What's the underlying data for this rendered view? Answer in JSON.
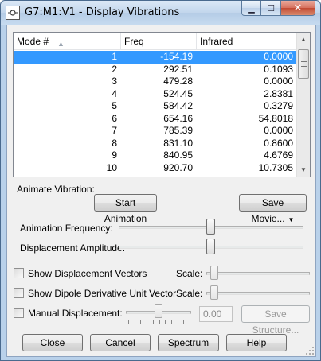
{
  "window": {
    "title": "G7:M1:V1 - Display Vibrations",
    "min_glyph": "▁",
    "max_glyph": "☐",
    "close_glyph": "✕"
  },
  "table": {
    "columns": [
      "Mode #",
      "Freq",
      "Infrared"
    ],
    "rows": [
      {
        "mode": "1",
        "freq": "-154.19",
        "ir": "0.0000"
      },
      {
        "mode": "2",
        "freq": "292.51",
        "ir": "0.1093"
      },
      {
        "mode": "3",
        "freq": "479.28",
        "ir": "0.0000"
      },
      {
        "mode": "4",
        "freq": "524.45",
        "ir": "2.8381"
      },
      {
        "mode": "5",
        "freq": "584.42",
        "ir": "0.3279"
      },
      {
        "mode": "6",
        "freq": "654.16",
        "ir": "54.8018"
      },
      {
        "mode": "7",
        "freq": "785.39",
        "ir": "0.0000"
      },
      {
        "mode": "8",
        "freq": "831.10",
        "ir": "0.8600"
      },
      {
        "mode": "9",
        "freq": "840.95",
        "ir": "4.6769"
      },
      {
        "mode": "10",
        "freq": "920.70",
        "ir": "10.7305"
      }
    ],
    "selected_row": 0
  },
  "animate": {
    "group_label": "Animate Vibration:",
    "start_button": "Start Animation",
    "save_movie_button": "Save Movie...",
    "frequency_label": "Animation Frequency:",
    "frequency_level": 0.5,
    "amplitude_label": "Displacement Amplitude:",
    "amplitude_level": 0.5
  },
  "options": {
    "show_displacement_vectors": "Show Displacement Vectors",
    "show_dipole_vector": "Show Dipole Derivative Unit Vector",
    "manual_displacement": "Manual Displacement:",
    "scale_label": "Scale:",
    "manual_value": "0.00",
    "save_structure_button": "Save Structure..."
  },
  "footer": {
    "close": "Close",
    "cancel": "Cancel",
    "spectrum": "Spectrum",
    "help": "Help"
  },
  "colors": {
    "selection": "#3399ff",
    "titlebar": "#c2d6ec",
    "dialog_bg": "#f0f0f0"
  }
}
